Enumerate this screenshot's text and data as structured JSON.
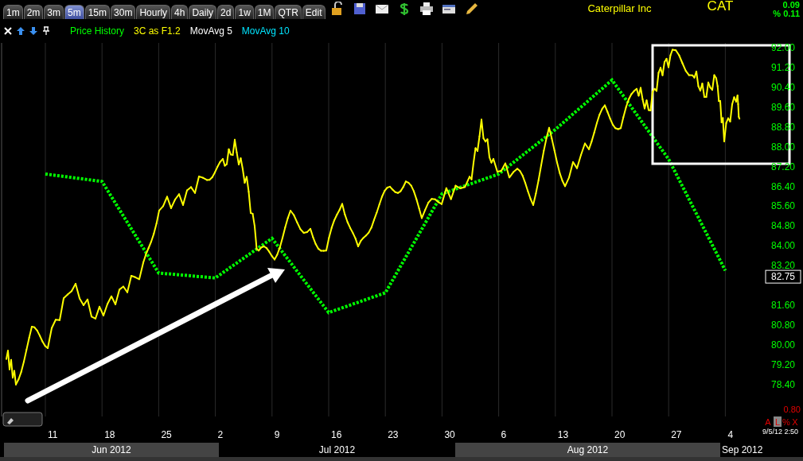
{
  "toolbar": {
    "tabs": [
      {
        "label": "1m",
        "selected": false
      },
      {
        "label": "2m",
        "selected": false
      },
      {
        "label": "3m",
        "selected": false
      },
      {
        "label": "5m",
        "selected": true
      },
      {
        "label": "15m",
        "selected": false
      },
      {
        "label": "30m",
        "selected": false
      },
      {
        "label": "Hourly",
        "selected": false
      },
      {
        "label": "4h",
        "selected": false
      },
      {
        "label": "Daily",
        "selected": false
      },
      {
        "label": "2d",
        "selected": false
      },
      {
        "label": "1w",
        "selected": false
      },
      {
        "label": "1M",
        "selected": false
      },
      {
        "label": "QTR",
        "selected": false
      },
      {
        "label": "Edit",
        "selected": false
      }
    ]
  },
  "symbol": {
    "company": "Caterpillar Inc",
    "ticker": "CAT",
    "change": "0.09",
    "percent_change": "% 0.11"
  },
  "legend": [
    {
      "label": "Price History",
      "color": "#00ff00"
    },
    {
      "label": "3C as F1.2",
      "color": "#ffff00"
    },
    {
      "label": "MovAvg 5",
      "color": "#ffffff"
    },
    {
      "label": "MovAvg 10",
      "color": "#00e5ff"
    }
  ],
  "chart": {
    "chart_data": {
      "type": "line",
      "categories": [
        "11",
        "18",
        "25",
        "2",
        "9",
        "16",
        "23",
        "30",
        "6",
        "13",
        "20",
        "27",
        "4"
      ],
      "series": [
        {
          "color": "#00ff00",
          "line_style": "dashed",
          "values": [
            86.9,
            86.6,
            82.9,
            82.7,
            84.3,
            81.3,
            82.1,
            86.1,
            86.9,
            88.7,
            90.7,
            87.5,
            83.0
          ]
        }
      ],
      "ylim": [
        77.1,
        92.2
      ],
      "yticks": [
        {
          "value": 92.0,
          "label": "92.00"
        },
        {
          "value": 91.2,
          "label": "91.20"
        },
        {
          "value": 90.4,
          "label": "90.40"
        },
        {
          "value": 89.6,
          "label": "89.60"
        },
        {
          "value": 88.8,
          "label": "88.80"
        },
        {
          "value": 88.0,
          "label": "88.00"
        },
        {
          "value": 87.2,
          "label": "87.20"
        },
        {
          "value": 86.4,
          "label": "86.40"
        },
        {
          "value": 85.6,
          "label": "85.60"
        },
        {
          "value": 84.8,
          "label": "84.80"
        },
        {
          "value": 84.0,
          "label": "84.00"
        },
        {
          "value": 83.2,
          "label": "83.20"
        },
        {
          "value": 81.6,
          "label": "81.60"
        },
        {
          "value": 80.8,
          "label": "80.80"
        },
        {
          "value": 80.0,
          "label": "80.00"
        },
        {
          "value": 79.2,
          "label": "79.20"
        },
        {
          "value": 78.4,
          "label": "78.40"
        }
      ]
    },
    "last_price": "82.75",
    "timestamp": "9/5/12 2:50",
    "scale_value": "0.80",
    "scale_buttons": [
      {
        "label": "A",
        "selected": false
      },
      {
        "label": "L",
        "selected": true
      },
      {
        "label": "%",
        "selected": false
      },
      {
        "label": "X",
        "selected": false
      }
    ],
    "months": [
      {
        "label": "Jun 2012",
        "shaded": true
      },
      {
        "label": "Jul 2012",
        "shaded": false
      },
      {
        "label": "Aug 2012",
        "shaded": true
      },
      {
        "label": "Sep 2012",
        "shaded": false
      }
    ]
  }
}
